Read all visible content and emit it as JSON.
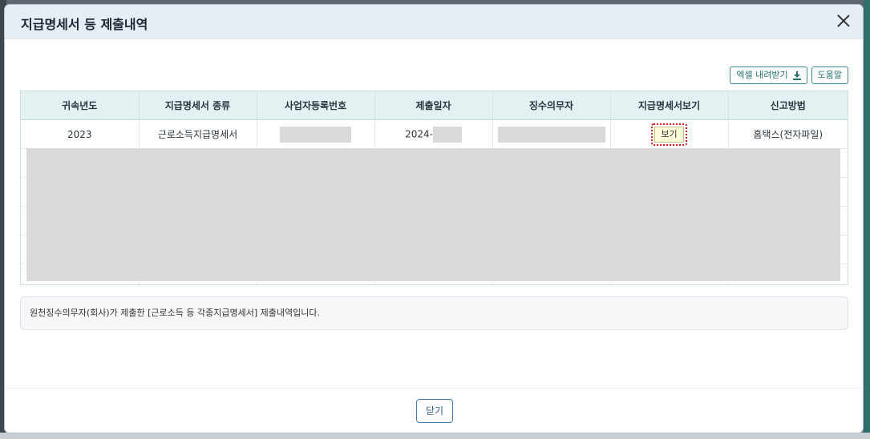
{
  "dialog": {
    "title": "지급명세서 등 제출내역",
    "close_icon": "close-icon"
  },
  "toolbar": {
    "excel_label": "엑셀 내려받기",
    "excel_icon": "download-icon",
    "help_label": "도움말"
  },
  "table": {
    "headers": [
      "귀속년도",
      "지급명세서 종류",
      "사업자등록번호",
      "제출일자",
      "징수의무자",
      "지급명세서보기",
      "신고방법"
    ],
    "rows": [
      {
        "year": "2023",
        "type": "근로소득지급명세서",
        "business_number": "",
        "submit_date": "2024-",
        "withholder": "",
        "view_label": "보기",
        "method": "홈택스(전자파일)"
      }
    ]
  },
  "notice": {
    "text": "원천징수의무자(회사)가 제출한 [근로소득 등 각종지급명세서] 제출내역입니다."
  },
  "footer": {
    "close_label": "닫기"
  },
  "colors": {
    "header_bg": "#e6edf5",
    "table_header_bg": "#e3f1f2",
    "accent": "#3d8b8c",
    "highlight": "#d0201a"
  }
}
